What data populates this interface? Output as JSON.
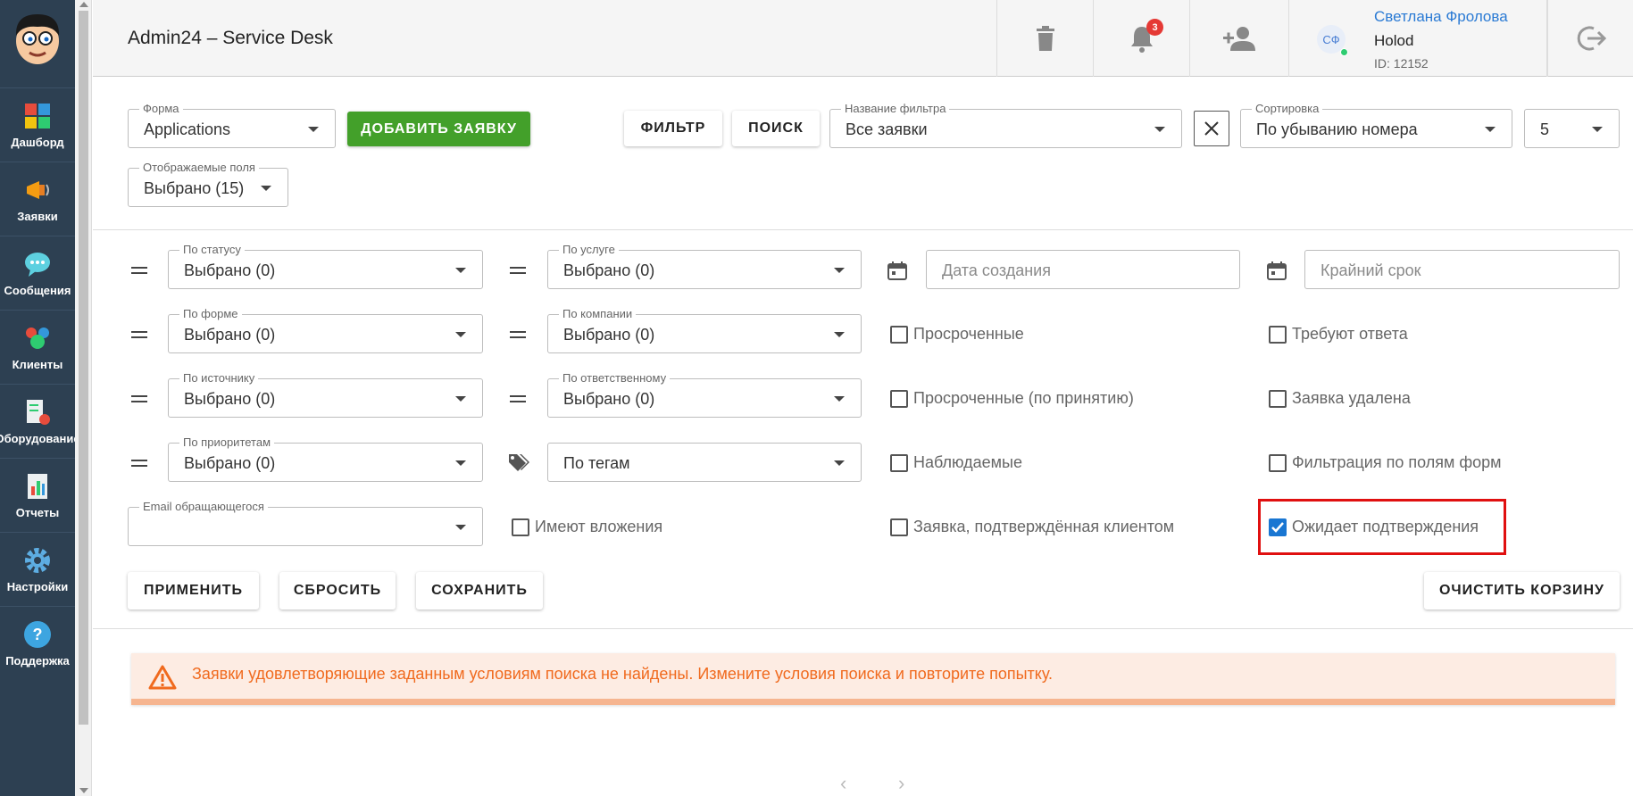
{
  "app": {
    "title": "Admin24 – Service Desk"
  },
  "sidebar": {
    "items": [
      {
        "label": "Дашборд",
        "icon": "dashboard-icon"
      },
      {
        "label": "Заявки",
        "icon": "megaphone-icon"
      },
      {
        "label": "Сообщения",
        "icon": "chat-icon"
      },
      {
        "label": "Клиенты",
        "icon": "clients-icon"
      },
      {
        "label": "Оборудование",
        "icon": "equipment-icon"
      },
      {
        "label": "Отчеты",
        "icon": "reports-icon"
      },
      {
        "label": "Настройки",
        "icon": "gear-icon"
      },
      {
        "label": "Поддержка",
        "icon": "help-icon"
      }
    ]
  },
  "header": {
    "notifications_count": "3",
    "user": {
      "initials": "СФ",
      "name": "Светлана Фролова",
      "org": "Holod",
      "id": "ID: 12152"
    }
  },
  "toolbar": {
    "form": {
      "label": "Форма",
      "value": "Applications"
    },
    "add_button": "ДОБАВИТЬ ЗАЯВКУ",
    "filter_button": "ФИЛЬТР",
    "search_button": "ПОИСК",
    "filter_name": {
      "label": "Название фильтра",
      "value": "Все заявки"
    },
    "sort": {
      "label": "Сортировка",
      "value": "По убыванию номера"
    },
    "page_size": "5",
    "fields": {
      "label": "Отображаемые поля",
      "value": "Выбрано (15)"
    }
  },
  "filters": {
    "by_status": {
      "label": "По статусу",
      "value": "Выбрано (0)"
    },
    "by_service": {
      "label": "По услуге",
      "value": "Выбрано (0)"
    },
    "by_form": {
      "label": "По форме",
      "value": "Выбрано (0)"
    },
    "by_company": {
      "label": "По компании",
      "value": "Выбрано (0)"
    },
    "by_source": {
      "label": "По источнику",
      "value": "Выбрано (0)"
    },
    "by_responsible": {
      "label": "По ответственному",
      "value": "Выбрано (0)"
    },
    "by_priority": {
      "label": "По приоритетам",
      "value": "Выбрано (0)"
    },
    "by_tags": {
      "value": "По тегам"
    },
    "email": {
      "label": "Email обращающегося",
      "value": ""
    },
    "created_date": {
      "placeholder": "Дата создания"
    },
    "deadline": {
      "placeholder": "Крайний срок"
    },
    "checkboxes": {
      "overdue": {
        "label": "Просроченные",
        "checked": false
      },
      "need_reply": {
        "label": "Требуют ответа",
        "checked": false
      },
      "overdue_accept": {
        "label": "Просроченные (по принятию)",
        "checked": false
      },
      "deleted": {
        "label": "Заявка удалена",
        "checked": false
      },
      "watched": {
        "label": "Наблюдаемые",
        "checked": false
      },
      "form_fields": {
        "label": "Фильтрация по полям форм",
        "checked": false
      },
      "attachments": {
        "label": "Имеют вложения",
        "checked": false
      },
      "client_confirmed": {
        "label": "Заявка, подтверждённая клиентом",
        "checked": false
      },
      "awaiting_confirm": {
        "label": "Ожидает подтверждения",
        "checked": true
      }
    }
  },
  "actions": {
    "apply": "ПРИМЕНИТЬ",
    "reset": "СБРОСИТЬ",
    "save": "СОХРАНИТЬ",
    "clear_trash": "ОЧИСТИТЬ КОРЗИНУ"
  },
  "alert": {
    "text": "Заявки удовлетворяющие заданным условиям поиска не найдены. Измените условия поиска и повторите попытку."
  },
  "pager": {
    "prev": "‹",
    "next": "›"
  },
  "colors": {
    "sidebar": "#2d4052",
    "accent": "#2a7ad4",
    "add_button": "#43a02a",
    "alert_text": "#f06a1e",
    "highlight": "#e01010"
  }
}
